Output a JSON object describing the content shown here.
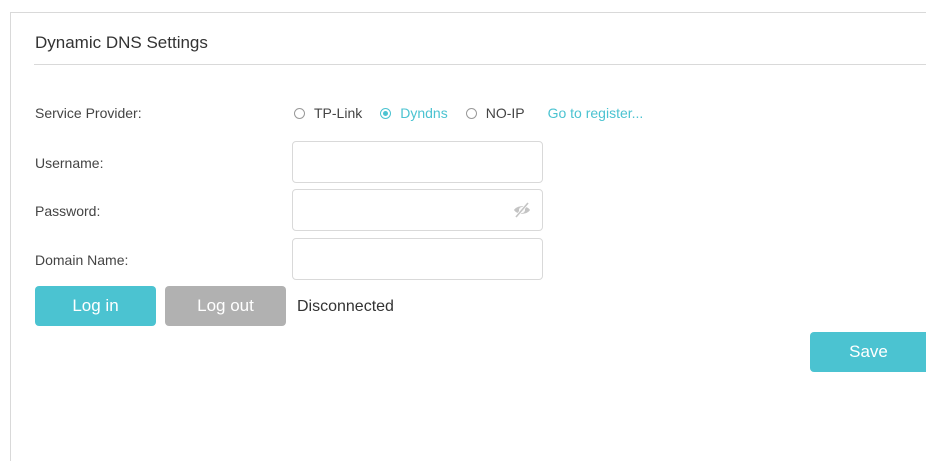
{
  "section": {
    "title": "Dynamic DNS Settings"
  },
  "service_provider": {
    "label": "Service Provider:",
    "options": [
      {
        "label": "TP-Link",
        "checked": false
      },
      {
        "label": "Dyndns",
        "checked": true
      },
      {
        "label": "NO-IP",
        "checked": false
      }
    ],
    "register_link": "Go to register..."
  },
  "form": {
    "username_label": "Username:",
    "username_value": "",
    "password_label": "Password:",
    "password_value": "",
    "password_icon": "eye-hidden-icon",
    "domain_label": "Domain Name:",
    "domain_value": ""
  },
  "actions": {
    "login_label": "Log in",
    "logout_label": "Log out",
    "status": "Disconnected",
    "save_label": "Save"
  },
  "colors": {
    "accent": "#4bc3d1",
    "disabled_button": "#b1b1b1",
    "border": "#d9d9d9"
  }
}
